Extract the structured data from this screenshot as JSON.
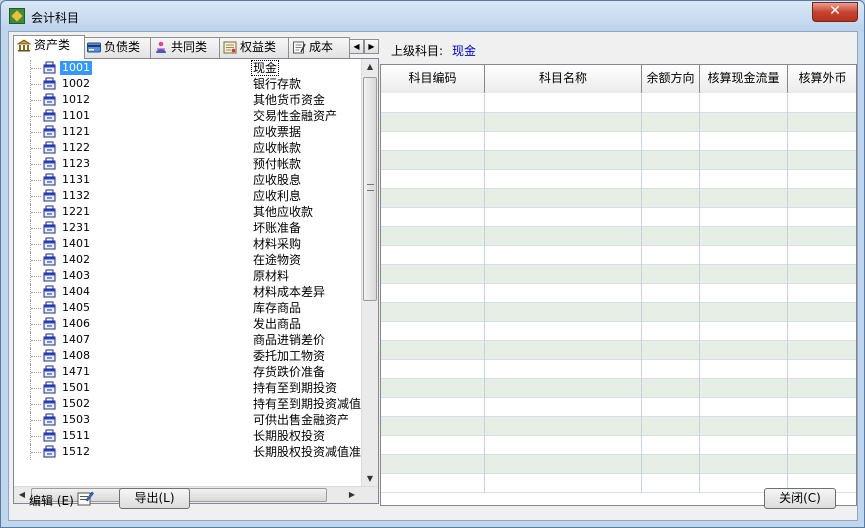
{
  "window": {
    "title": "会计科目",
    "close_glyph": "✕"
  },
  "tabs": [
    {
      "label": "资产类",
      "icon": "bank-icon",
      "active": true
    },
    {
      "label": "负债类",
      "icon": "card-icon",
      "active": false
    },
    {
      "label": "共同类",
      "icon": "people-icon",
      "active": false
    },
    {
      "label": "权益类",
      "icon": "certificate-icon",
      "active": false
    },
    {
      "label": "成本",
      "icon": "notepad-icon",
      "active": false
    }
  ],
  "tab_scroll": {
    "left": "◀",
    "right": "▶"
  },
  "tree": {
    "selected_code": "1001",
    "items": [
      {
        "code": "1001",
        "name": "现金"
      },
      {
        "code": "1002",
        "name": "银行存款"
      },
      {
        "code": "1012",
        "name": "其他货币资金"
      },
      {
        "code": "1101",
        "name": "交易性金融资产"
      },
      {
        "code": "1121",
        "name": "应收票据"
      },
      {
        "code": "1122",
        "name": "应收帐款"
      },
      {
        "code": "1123",
        "name": "预付帐款"
      },
      {
        "code": "1131",
        "name": "应收股息"
      },
      {
        "code": "1132",
        "name": "应收利息"
      },
      {
        "code": "1221",
        "name": "其他应收款"
      },
      {
        "code": "1231",
        "name": "坏账准备"
      },
      {
        "code": "1401",
        "name": "材料采购"
      },
      {
        "code": "1402",
        "name": "在途物资"
      },
      {
        "code": "1403",
        "name": "原材料"
      },
      {
        "code": "1404",
        "name": "材料成本差异"
      },
      {
        "code": "1405",
        "name": "库存商品"
      },
      {
        "code": "1406",
        "name": "发出商品"
      },
      {
        "code": "1407",
        "name": "商品进销差价"
      },
      {
        "code": "1408",
        "name": "委托加工物资"
      },
      {
        "code": "1471",
        "name": "存货跌价准备"
      },
      {
        "code": "1501",
        "name": "持有至到期投资"
      },
      {
        "code": "1502",
        "name": "持有至到期投资减值"
      },
      {
        "code": "1503",
        "name": "可供出售金融资产"
      },
      {
        "code": "1511",
        "name": "长期股权投资"
      },
      {
        "code": "1512",
        "name": "长期股权投资减值准"
      }
    ]
  },
  "scrollbars": {
    "up": "▲",
    "down": "▼",
    "left": "◀",
    "right": "▶"
  },
  "parent_subject": {
    "label": "上级科目:",
    "value": "现金"
  },
  "grid": {
    "columns": [
      "科目编码",
      "科目名称",
      "余额方向",
      "核算现金流量",
      "核算外币"
    ],
    "row_count": 21,
    "colors": {
      "alt_row": "#e6eee6",
      "header": "#f3f3f3"
    }
  },
  "footer": {
    "edit_label": "编辑 (E)",
    "export_button": "导出(L)",
    "close_button": "关闭(C)"
  }
}
